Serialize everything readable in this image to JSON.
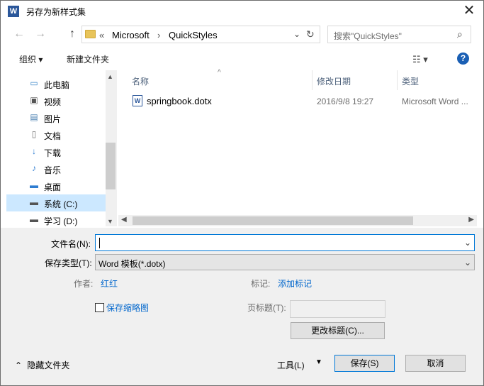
{
  "window": {
    "title": "另存为新样式集",
    "close_glyph": "✕"
  },
  "nav": {
    "back": "←",
    "forward": "→",
    "up": "↑"
  },
  "address": {
    "prefix": "«",
    "crumbs": [
      "Microsoft",
      "QuickStyles"
    ],
    "separator": "›"
  },
  "search": {
    "placeholder": "搜索\"QuickStyles\""
  },
  "toolbar": {
    "organize": "组织 ▾",
    "new_folder": "新建文件夹",
    "help": "?"
  },
  "sidebar": {
    "items": [
      {
        "label": "此电脑",
        "icon": "computer-icon"
      },
      {
        "label": "视频",
        "icon": "video-icon"
      },
      {
        "label": "图片",
        "icon": "pictures-icon"
      },
      {
        "label": "文档",
        "icon": "documents-icon"
      },
      {
        "label": "下载",
        "icon": "download-icon"
      },
      {
        "label": "音乐",
        "icon": "music-icon"
      },
      {
        "label": "桌面",
        "icon": "desktop-icon"
      },
      {
        "label": "系统 (C:)",
        "icon": "drive-c-icon",
        "selected": true
      },
      {
        "label": "学习 (D:)",
        "icon": "drive-d-icon"
      }
    ]
  },
  "columns": {
    "name": "名称",
    "modified": "修改日期",
    "type": "类型"
  },
  "files": [
    {
      "name": "springbook.dotx",
      "modified": "2016/9/8 19:27",
      "type": "Microsoft Word ..."
    }
  ],
  "form": {
    "filename_label": "文件名(N):",
    "filename_value": "",
    "filetype_label": "保存类型(T):",
    "filetype_value": "Word 模板(*.dotx)",
    "author_label": "作者:",
    "author_value": "红红",
    "tags_label": "标记:",
    "tags_value": "添加标记",
    "thumbnail_label": "保存缩略图",
    "subject_label": "页标题(T):",
    "change_title_button": "更改标题(C)..."
  },
  "footer": {
    "hide_folders": "隐藏文件夹",
    "tools": "工具(L)",
    "save": "保存(S)",
    "cancel": "取消"
  }
}
